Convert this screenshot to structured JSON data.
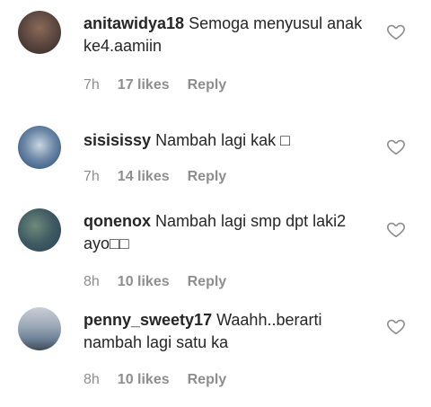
{
  "comments": [
    {
      "username": "anitawidya18",
      "text": "Semoga menyusul anak ke4.aamiin",
      "time": "7h",
      "likes": "17 likes",
      "reply": "Reply",
      "avatar_icon": "avatar-photo-icon",
      "avatar_colors": [
        "#4a3a35",
        "#8a6a5a"
      ]
    },
    {
      "username": "sisisissy",
      "text": "Nambah lagi kak □",
      "time": "7h",
      "likes": "14 likes",
      "reply": "Reply",
      "avatar_icon": "avatar-photo-icon",
      "avatar_colors": [
        "#3e5f88",
        "#c9d6e2"
      ]
    },
    {
      "username": "qonenox",
      "text": "Nambah lagi smp dpt laki2 ayo□□",
      "time": "8h",
      "likes": "10 likes",
      "reply": "Reply",
      "avatar_icon": "avatar-photo-icon",
      "avatar_colors": [
        "#2f4a5c",
        "#6e8a7c"
      ]
    },
    {
      "username": "penny_sweety17",
      "text": "Waahh..berarti nambah lagi satu ka",
      "time": "8h",
      "likes": "10 likes",
      "reply": "Reply",
      "avatar_icon": "avatar-photo-icon",
      "avatar_colors": [
        "#6b7f95",
        "#c8ced6"
      ]
    }
  ],
  "colors": {
    "text": "#262626",
    "meta": "#8e8e8e",
    "heart": "#8e8e8e"
  },
  "icons": {
    "like": "heart-outline-icon"
  }
}
